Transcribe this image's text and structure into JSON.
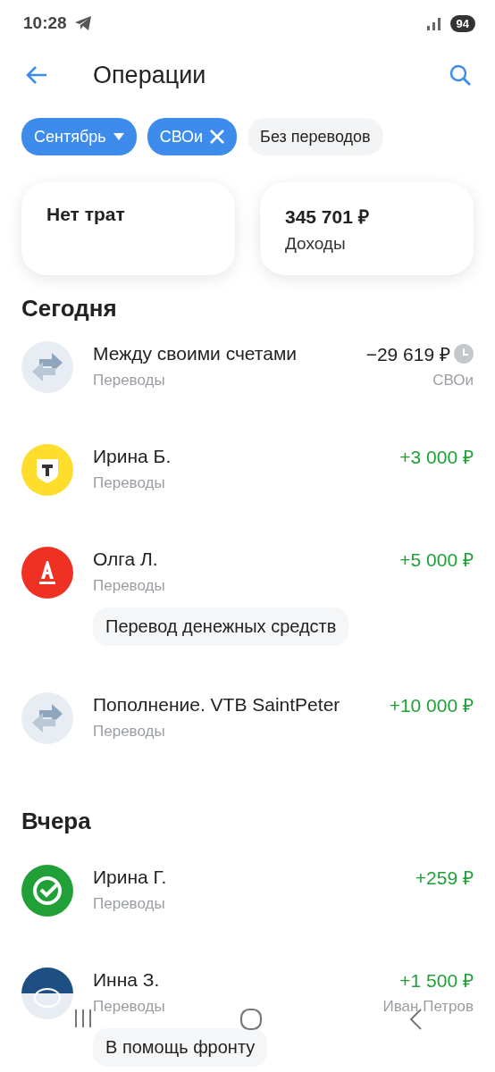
{
  "status_bar": {
    "time": "10:28",
    "battery": "94"
  },
  "header": {
    "title": "Операции"
  },
  "filters": [
    {
      "label": "Сентябрь",
      "selected": true,
      "kind": "dropdown"
    },
    {
      "label": "СВОи",
      "selected": true,
      "kind": "removable"
    },
    {
      "label": "Без переводов",
      "selected": false,
      "kind": "toggle"
    }
  ],
  "summary": [
    {
      "value": "Нет трат"
    },
    {
      "value": "345 701 ₽",
      "label": "Доходы"
    }
  ],
  "groups": [
    {
      "title": "Сегодня",
      "items": [
        {
          "kind": "transfer",
          "name": "Между своими счетами",
          "category": "Переводы",
          "amount": "−29 619 ₽",
          "income": false,
          "pending": true,
          "account": "СВОи"
        },
        {
          "kind": "tbank",
          "name": "Ирина Б.",
          "category": "Переводы",
          "amount": "+3 000 ₽",
          "income": true,
          "pending": false
        },
        {
          "kind": "alfa",
          "name": "Олга Л.",
          "category": "Переводы",
          "amount": "+5 000 ₽",
          "income": true,
          "pending": false,
          "note": "Перевод денежных средств"
        },
        {
          "kind": "transfer",
          "name": "Пополнение. VTB SaintPeter",
          "category": "Переводы",
          "amount": "+10 000 ₽",
          "income": true,
          "pending": false
        }
      ]
    },
    {
      "title": "Вчера",
      "items": [
        {
          "kind": "sber",
          "name": "Ирина Г.",
          "category": "Переводы",
          "amount": "+259 ₽",
          "income": true,
          "pending": false
        },
        {
          "kind": "gazprom",
          "name": "Инна З.",
          "category": "Переводы",
          "amount": "+1 500 ₽",
          "income": true,
          "pending": false,
          "account": "Иван Петров",
          "note": "В помощь фронту"
        }
      ]
    }
  ]
}
